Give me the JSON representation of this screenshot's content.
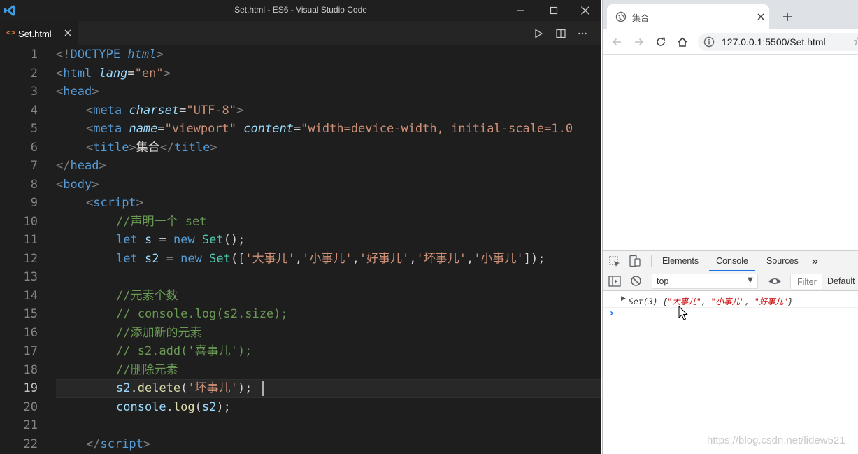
{
  "vscode": {
    "window_title": "Set.html - ES6 - Visual Studio Code",
    "tab": {
      "icon": "<>",
      "label": "Set.html"
    },
    "line_numbers": [
      "1",
      "2",
      "3",
      "4",
      "5",
      "6",
      "7",
      "8",
      "9",
      "10",
      "11",
      "12",
      "13",
      "14",
      "15",
      "16",
      "17",
      "18",
      "19",
      "20",
      "21",
      "22"
    ],
    "active_line": 19
  },
  "browser": {
    "tab_title": "集合",
    "url": "127.0.0.1:5500/Set.html",
    "devtools": {
      "tabs": {
        "elements": "Elements",
        "console": "Console",
        "sources": "Sources",
        "more": "»"
      },
      "context": "top",
      "filter_placeholder": "Filter",
      "levels": "Default",
      "log": {
        "object_name": "Set(3)",
        "open": " {",
        "v1": "\"大事儿\"",
        "sep1": ", ",
        "v2": "\"小事儿\"",
        "sep2": ", ",
        "v3": "\"好事儿\"",
        "close": "}"
      },
      "prompt": "›"
    }
  },
  "watermark": "https://blog.csdn.net/lidew521",
  "code": {
    "l1": {
      "a": "<!",
      "b": "DOCTYPE",
      "c": " ",
      "d": "html",
      "e": ">"
    },
    "l2": {
      "a": "<",
      "b": "html",
      "c": " ",
      "d": "lang",
      "e": "=",
      "f": "\"en\"",
      "g": ">"
    },
    "l3": {
      "a": "<",
      "b": "head",
      "c": ">"
    },
    "l4": {
      "a": "<",
      "b": "meta",
      "c": " ",
      "d": "charset",
      "e": "=",
      "f": "\"UTF-8\"",
      "g": ">"
    },
    "l5": {
      "a": "<",
      "b": "meta",
      "c": " ",
      "d": "name",
      "e": "=",
      "f": "\"viewport\"",
      "g": " ",
      "h": "content",
      "i": "=",
      "j": "\"width=device-width, initial-scale=1.0"
    },
    "l6": {
      "a": "<",
      "b": "title",
      "c": ">",
      "d": "集合",
      "e": "</",
      "f": "title",
      "g": ">"
    },
    "l7": {
      "a": "</",
      "b": "head",
      "c": ">"
    },
    "l8": {
      "a": "<",
      "b": "body",
      "c": ">"
    },
    "l9": {
      "a": "<",
      "b": "script",
      "c": ">"
    },
    "l10": {
      "a": "//声明一个 set"
    },
    "l11": {
      "a": "let",
      "b": " ",
      "c": "s",
      "d": " = ",
      "e": "new",
      "f": " ",
      "g": "Set",
      "h": "();"
    },
    "l12": {
      "a": "let",
      "b": " ",
      "c": "s2",
      "d": " = ",
      "e": "new",
      "f": " ",
      "g": "Set",
      "h": "([",
      "i": "'大事儿'",
      "j": ",",
      "k": "'小事儿'",
      "l": ",",
      "m": "'好事儿'",
      "n": ",",
      "o": "'坏事儿'",
      "p": ",",
      "q": "'小事儿'",
      "r": "]);"
    },
    "l14": {
      "a": "//元素个数"
    },
    "l15": {
      "a": "// console.log(s2.size);"
    },
    "l16": {
      "a": "//添加新的元素"
    },
    "l17": {
      "a": "// s2.add('喜事儿');"
    },
    "l18": {
      "a": "//删除元素"
    },
    "l19": {
      "a": "s2",
      "b": ".",
      "c": "delete",
      "d": "(",
      "e": "'坏事儿'",
      "f": ");"
    },
    "l20": {
      "a": "console",
      "b": ".",
      "c": "log",
      "d": "(",
      "e": "s2",
      "f": ");"
    },
    "l22": {
      "a": "</",
      "b": "script",
      "c": ">"
    }
  },
  "colors": {
    "editor_bg": "#1e1e1e",
    "keyword": "#569cd6",
    "string": "#ce9178",
    "comment": "#6a9955",
    "function": "#dcdcaa",
    "variable": "#9cdcfe",
    "console_string": "#c80000",
    "devtools_active_tab": "#1a73e8"
  }
}
